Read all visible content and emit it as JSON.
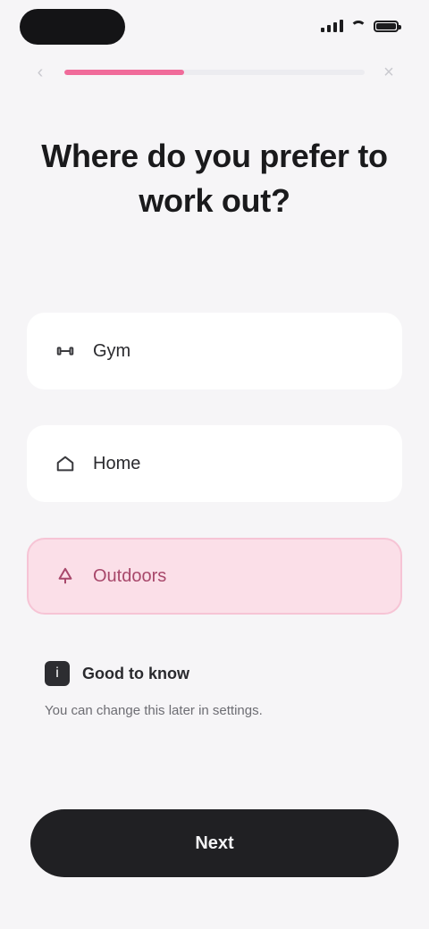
{
  "status_bar": {
    "icons": [
      "signal-icon",
      "wifi-icon",
      "battery-icon"
    ]
  },
  "header": {
    "progress": 0.4,
    "accent_color": "#f06b9a",
    "back_icon": "chevron-left-icon",
    "close_icon": "close-icon"
  },
  "title": "Where do you prefer to work out?",
  "options": [
    {
      "label": "Gym",
      "icon": "dumbbell-icon",
      "selected": false
    },
    {
      "label": "Home",
      "icon": "home-icon",
      "selected": false
    },
    {
      "label": "Outdoors",
      "icon": "tree-icon",
      "selected": true
    }
  ],
  "info": {
    "icon": "info-icon",
    "title": "Good to know",
    "body": "You can change this later in settings."
  },
  "primary_button": {
    "label": "Next",
    "background": "#202023"
  }
}
